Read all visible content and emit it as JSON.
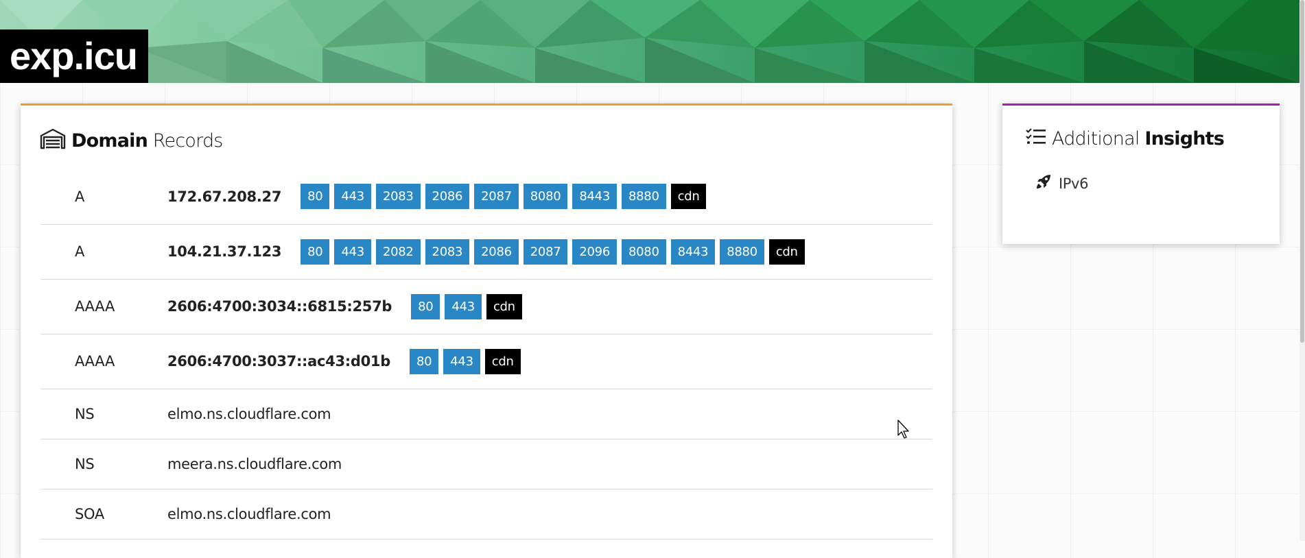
{
  "site": {
    "logo": "exp.icu"
  },
  "records_card": {
    "title_bold": "Domain",
    "title_rest": "Records",
    "icon": "warehouse-icon",
    "accent": "#e8a22a",
    "rows": [
      {
        "type": "A",
        "value": "172.67.208.27",
        "strong": true,
        "ports": [
          "80",
          "443",
          "2083",
          "2086",
          "2087",
          "8080",
          "8443",
          "8880"
        ],
        "tag": "cdn"
      },
      {
        "type": "A",
        "value": "104.21.37.123",
        "strong": true,
        "ports": [
          "80",
          "443",
          "2082",
          "2083",
          "2086",
          "2087",
          "2096",
          "8080",
          "8443",
          "8880"
        ],
        "tag": "cdn"
      },
      {
        "type": "AAAA",
        "value": "2606:4700:3034::6815:257b",
        "strong": true,
        "ports": [
          "80",
          "443"
        ],
        "tag": "cdn"
      },
      {
        "type": "AAAA",
        "value": "2606:4700:3037::ac43:d01b",
        "strong": true,
        "ports": [
          "80",
          "443"
        ],
        "tag": "cdn"
      },
      {
        "type": "NS",
        "value": "elmo.ns.cloudflare.com",
        "strong": false,
        "ports": [],
        "tag": ""
      },
      {
        "type": "NS",
        "value": "meera.ns.cloudflare.com",
        "strong": false,
        "ports": [],
        "tag": ""
      },
      {
        "type": "SOA",
        "value": "elmo.ns.cloudflare.com",
        "strong": false,
        "ports": [],
        "tag": ""
      }
    ]
  },
  "insights_card": {
    "title_rest": "Additional",
    "title_bold": "Insights",
    "icon": "checklist-icon",
    "accent": "#a31fb5",
    "items": [
      {
        "icon": "rocket-icon",
        "label": "IPv6"
      }
    ]
  },
  "colors": {
    "port": "#2a87c5",
    "cdn": "#000000"
  }
}
